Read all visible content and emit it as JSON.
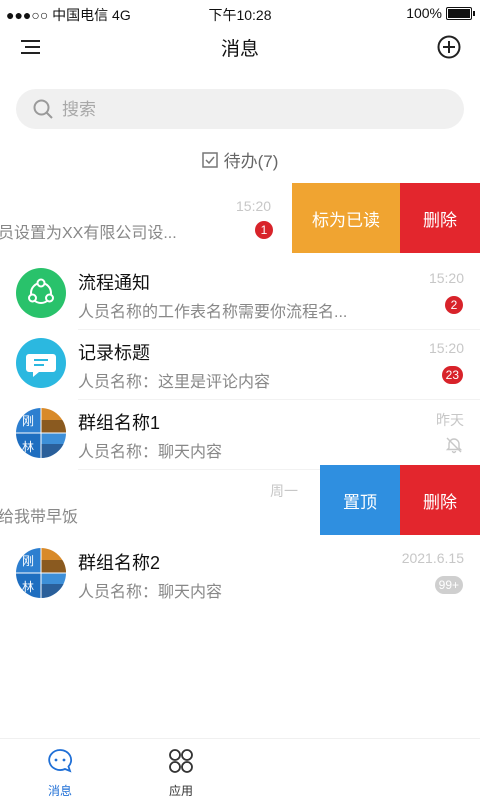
{
  "status_bar": {
    "carrier": "●●●○○ 中国电信 4G",
    "time": "下午10:28",
    "battery": "100%"
  },
  "header": {
    "title": "消息",
    "menu_icon": "list-menu-icon",
    "add_icon": "plus-circle-icon"
  },
  "search": {
    "placeholder": "搜索",
    "icon": "search-icon"
  },
  "todo": {
    "label": "待办(7)",
    "icon": "checkbox-icon"
  },
  "conversations": [
    {
      "title": "",
      "preview": "员设置为XX有限公司设...",
      "time": "15:20",
      "badge": "1",
      "swipe_actions": [
        "标为已读",
        "删除"
      ]
    },
    {
      "title": "流程通知",
      "preview": "人员名称的工作表名称需要你流程名...",
      "time": "15:20",
      "badge": "2",
      "icon": "share-icon"
    },
    {
      "title": "记录标题",
      "preview": "人员名称：这里是评论内容",
      "time": "15:20",
      "badge": "23",
      "icon": "comment-icon"
    },
    {
      "title": "群组名称1",
      "preview": "人员名称：聊天内容",
      "time": "昨天",
      "muted_icon": "bell-off-icon",
      "avatar_chars": [
        "刚",
        "林"
      ]
    },
    {
      "title": "",
      "preview": "给我带早饭",
      "time": "周一",
      "swipe_actions": [
        "置顶",
        "删除"
      ]
    },
    {
      "title": "群组名称2",
      "preview": "人员名称：聊天内容",
      "time": "2021.6.15",
      "badge": "99+",
      "avatar_chars": [
        "刚",
        "林"
      ]
    }
  ],
  "tabbar": [
    {
      "label": "消息",
      "icon": "chat-bubble-icon",
      "active": true
    },
    {
      "label": "应用",
      "icon": "apps-grid-icon",
      "active": false
    }
  ],
  "colors": {
    "accent": "#1f6fd6",
    "badge_red": "#d8232a",
    "mark_read": "#f0a431",
    "delete": "#e3262d",
    "pin": "#2f8fe0",
    "flow_icon_bg": "#29c26b",
    "comment_icon_bg": "#2bb8e0"
  }
}
